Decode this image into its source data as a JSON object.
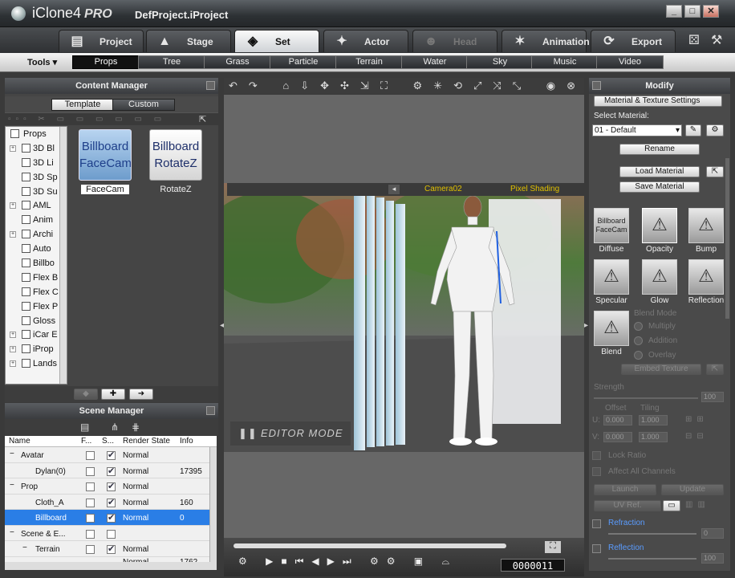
{
  "window": {
    "app_name": "iClone4",
    "edition": "PRO",
    "project": "DefProject.iProject",
    "controls": [
      "_",
      "□",
      "✕"
    ]
  },
  "main_tabs": [
    {
      "label": "Project",
      "icon": "project-icon",
      "state": "normal"
    },
    {
      "label": "Stage",
      "icon": "stage-icon",
      "state": "normal"
    },
    {
      "label": "Set",
      "icon": "set-icon",
      "state": "active"
    },
    {
      "label": "Actor",
      "icon": "actor-icon",
      "state": "normal"
    },
    {
      "label": "Head",
      "icon": "head-icon",
      "state": "disabled"
    },
    {
      "label": "Animation",
      "icon": "animation-icon",
      "state": "normal"
    },
    {
      "label": "Export",
      "icon": "export-icon",
      "state": "normal"
    }
  ],
  "sub_bar": {
    "tools_label": "Tools ▾",
    "tabs": [
      "Props",
      "Tree",
      "Grass",
      "Particle",
      "Terrain",
      "Water",
      "Sky",
      "Music",
      "Video"
    ],
    "active": "Props"
  },
  "content_manager": {
    "title": "Content Manager",
    "tabs": [
      "Template",
      "Custom"
    ],
    "active_tab": "Template",
    "tree_root": "Props",
    "tree_items": [
      "3D Bl",
      "3D Li",
      "3D Sp",
      "3D Su",
      "AML",
      "Anim",
      "Archi",
      "Auto",
      "Billbo",
      "Flex B",
      "Flex C",
      "Flex P",
      "Gloss",
      "iCar E",
      "iProp",
      "Lands"
    ],
    "thumbnails": [
      {
        "line1": "Billboard",
        "line2": "FaceCam",
        "label": "FaceCam"
      },
      {
        "line1": "Billboard",
        "line2": "RotateZ",
        "label": "RotateZ"
      }
    ]
  },
  "scene_manager": {
    "title": "Scene Manager",
    "columns": [
      "Name",
      "F...",
      "S...",
      "Render State",
      "Info"
    ],
    "rows": [
      {
        "name": "Avatar",
        "indent": 0,
        "group": true,
        "s": true,
        "state": "Normal",
        "info": ""
      },
      {
        "name": "Dylan(0)",
        "indent": 1,
        "group": false,
        "s": true,
        "state": "Normal",
        "info": "17395"
      },
      {
        "name": "Prop",
        "indent": 0,
        "group": true,
        "s": true,
        "state": "Normal",
        "info": ""
      },
      {
        "name": "Cloth_A",
        "indent": 1,
        "group": false,
        "s": true,
        "state": "Normal",
        "info": "160"
      },
      {
        "name": "Billboard",
        "indent": 1,
        "group": false,
        "s": true,
        "state": "Normal",
        "info": "0",
        "selected": true
      },
      {
        "name": "Scene & E...",
        "indent": 0,
        "group": true,
        "s": false,
        "state": "",
        "info": ""
      },
      {
        "name": "Terrain",
        "indent": 1,
        "group": true,
        "s": true,
        "state": "Normal",
        "info": ""
      }
    ],
    "partial_row": {
      "state": "Normal",
      "info": "1762"
    }
  },
  "viewport": {
    "camera": "Camera02",
    "shading": "Pixel Shading",
    "mode": "EDITOR MODE",
    "frame": "0000011"
  },
  "modify": {
    "title": "Modify",
    "section": "Material & Texture Settings",
    "select_material_label": "Select Material:",
    "material_value": "01 - Default",
    "rename": "Rename",
    "load": "Load Material",
    "save": "Save Material",
    "channels": [
      "Diffuse",
      "Opacity",
      "Bump",
      "Specular",
      "Glow",
      "Reflection",
      "Blend"
    ],
    "blend_mode_label": "Blend Mode",
    "blend_modes": [
      "Multiply",
      "Addition",
      "Overlay"
    ],
    "embed": "Embed Texture",
    "strength_label": "Strength",
    "strength_value": "100",
    "offset_label": "Offset",
    "tiling_label": "Tiling",
    "u_label": "U:",
    "v_label": "V:",
    "u_offset": "0.000",
    "u_tiling": "1.000",
    "v_offset": "0.000",
    "v_tiling": "1.000",
    "lock_ratio": "Lock Ratio",
    "affect_all": "Affect All Channels",
    "launch": "Launch",
    "update": "Update",
    "uv_ref": "UV Ref.",
    "refraction": "Refraction",
    "refraction_value": "0",
    "reflection": "Reflection",
    "reflection_value": "100"
  }
}
